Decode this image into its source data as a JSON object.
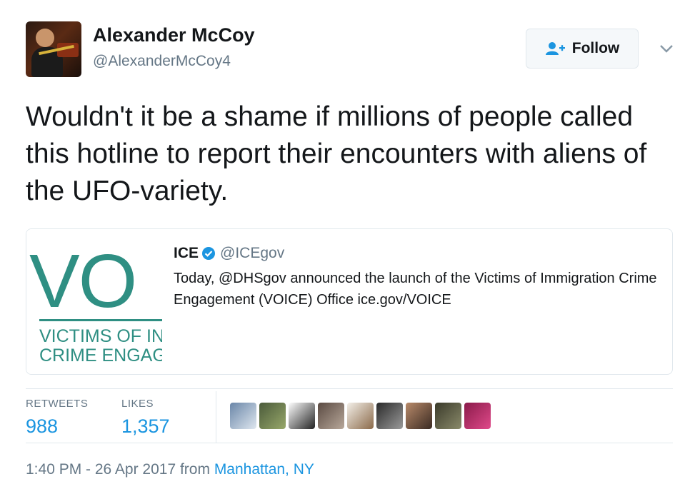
{
  "author": {
    "name": "Alexander McCoy",
    "handle": "@AlexanderMcCoy4"
  },
  "follow_button": {
    "label": "Follow",
    "icon": "add-user-icon"
  },
  "menu": {
    "icon": "chevron-down-icon"
  },
  "tweet": {
    "text": "Wouldn't it be a shame if millions of people called this hotline to report their encounters with aliens of the UFO-variety."
  },
  "quoted_tweet": {
    "name": "ICE",
    "verified_icon": "verified-badge-icon",
    "handle": "@ICEgov",
    "text": "Today, @DHSgov announced the launch of the Victims of Immigration Crime Engagement (VOICE) Office ice.gov/VOICE",
    "image": {
      "big_text": "VO",
      "line1": "VICTIMS OF IN",
      "line2": "CRIME ENGAG"
    }
  },
  "stats": {
    "retweets_label": "RETWEETS",
    "retweets_value": "988",
    "likes_label": "LIKES",
    "likes_value": "1,357"
  },
  "likers": [
    {
      "name": "liker-avatar-1",
      "colors": [
        "#6a86a8",
        "#dfe7ef"
      ]
    },
    {
      "name": "liker-avatar-2",
      "colors": [
        "#4a5a3a",
        "#98a86a"
      ]
    },
    {
      "name": "liker-avatar-3",
      "colors": [
        "#ffffff",
        "#222222"
      ]
    },
    {
      "name": "liker-avatar-4",
      "colors": [
        "#5a4a42",
        "#b8a89a"
      ]
    },
    {
      "name": "liker-avatar-5",
      "colors": [
        "#f3efe8",
        "#8b6a4a"
      ]
    },
    {
      "name": "liker-avatar-6",
      "colors": [
        "#2a2a2a",
        "#9a9a9a"
      ]
    },
    {
      "name": "liker-avatar-7",
      "colors": [
        "#b88a6a",
        "#3a2a22"
      ]
    },
    {
      "name": "liker-avatar-8",
      "colors": [
        "#3a3a2a",
        "#8a8a6a"
      ]
    },
    {
      "name": "liker-avatar-9",
      "colors": [
        "#8a1a4a",
        "#e04a8a"
      ]
    }
  ],
  "meta": {
    "time": "1:40 PM - 26 Apr 2017 from ",
    "location": "Manhattan, NY"
  },
  "colors": {
    "link": "#1b95e0",
    "muted": "#657786",
    "border": "#e1e8ed",
    "voice_teal": "#2f8f83"
  }
}
